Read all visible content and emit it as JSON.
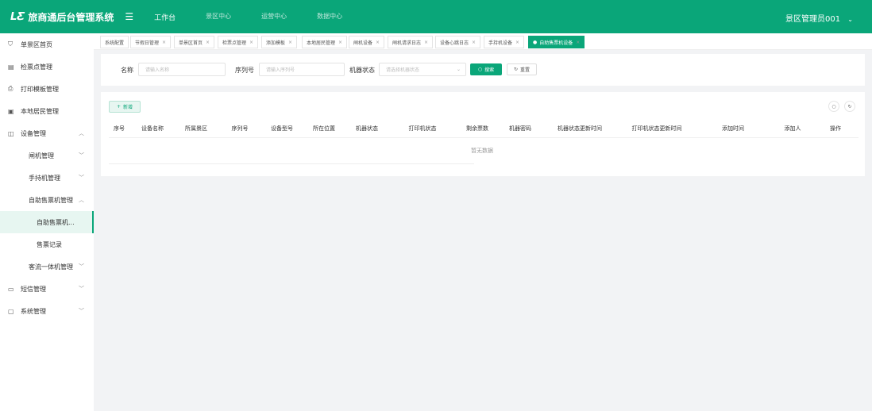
{
  "header": {
    "logo_mark": "LS",
    "title": "旅商通后台管理系统",
    "menu_icon": "menu-fold-icon",
    "nav": [
      "工作台",
      "景区中心",
      "运营中心",
      "数据中心"
    ],
    "user": "景区管理员001"
  },
  "sidebar": {
    "items": [
      {
        "label": "单景区首页",
        "icon": "shield-icon",
        "level": 0
      },
      {
        "label": "检票点管理",
        "icon": "ticket-icon",
        "level": 0
      },
      {
        "label": "打印模板管理",
        "icon": "printer-icon",
        "level": 0
      },
      {
        "label": "本地居民管理",
        "icon": "user-card-icon",
        "level": 0
      },
      {
        "label": "设备管理",
        "icon": "device-icon",
        "level": 0,
        "expanded": true
      },
      {
        "label": "闸机管理",
        "level": 1,
        "chevron": "down"
      },
      {
        "label": "手持机管理",
        "level": 1,
        "chevron": "down"
      },
      {
        "label": "自助售票机管理",
        "level": 1,
        "chevron": "up"
      },
      {
        "label": "自助售票机...",
        "level": 2,
        "active": true
      },
      {
        "label": "售票记录",
        "level": 2
      },
      {
        "label": "客流一体机管理",
        "level": 1,
        "chevron": "down"
      },
      {
        "label": "短信管理",
        "icon": "message-icon",
        "level": 0,
        "chevron": "down"
      },
      {
        "label": "系统管理",
        "icon": "settings-icon",
        "level": 0,
        "chevron": "down"
      }
    ]
  },
  "tabs": [
    {
      "label": "系统配置",
      "closable": false
    },
    {
      "label": "节假日管理",
      "closable": true
    },
    {
      "label": "单景区首页",
      "closable": true
    },
    {
      "label": "检票点管理",
      "closable": true
    },
    {
      "label": "添加模板",
      "closable": true
    },
    {
      "label": "本地居民管理",
      "closable": true
    },
    {
      "label": "闸机设备",
      "closable": true
    },
    {
      "label": "闸机请求日志",
      "closable": true
    },
    {
      "label": "设备心跳日志",
      "closable": true
    },
    {
      "label": "手持机设备",
      "closable": true
    },
    {
      "label": "自助售票机设备",
      "closable": true,
      "active": true
    }
  ],
  "search": {
    "name_label": "名称",
    "name_placeholder": "请输入名称",
    "serial_label": "序列号",
    "serial_placeholder": "请输入序列号",
    "status_label": "机器状态",
    "status_placeholder": "请选择机器状态",
    "search_button": "搜索",
    "reset_button": "重置"
  },
  "table": {
    "add_button": "新增",
    "columns": [
      "序号",
      "设备名称",
      "所属景区",
      "序列号",
      "设备型号",
      "所在位置",
      "机器状态",
      "打印机状态",
      "剩余票数",
      "机器密码",
      "机器状态更新时间",
      "打印机状态更新时间",
      "添加时间",
      "添加人",
      "操作"
    ],
    "rows": [],
    "empty_text": "暂无数据"
  },
  "colors": {
    "primary": "#0aa679"
  }
}
